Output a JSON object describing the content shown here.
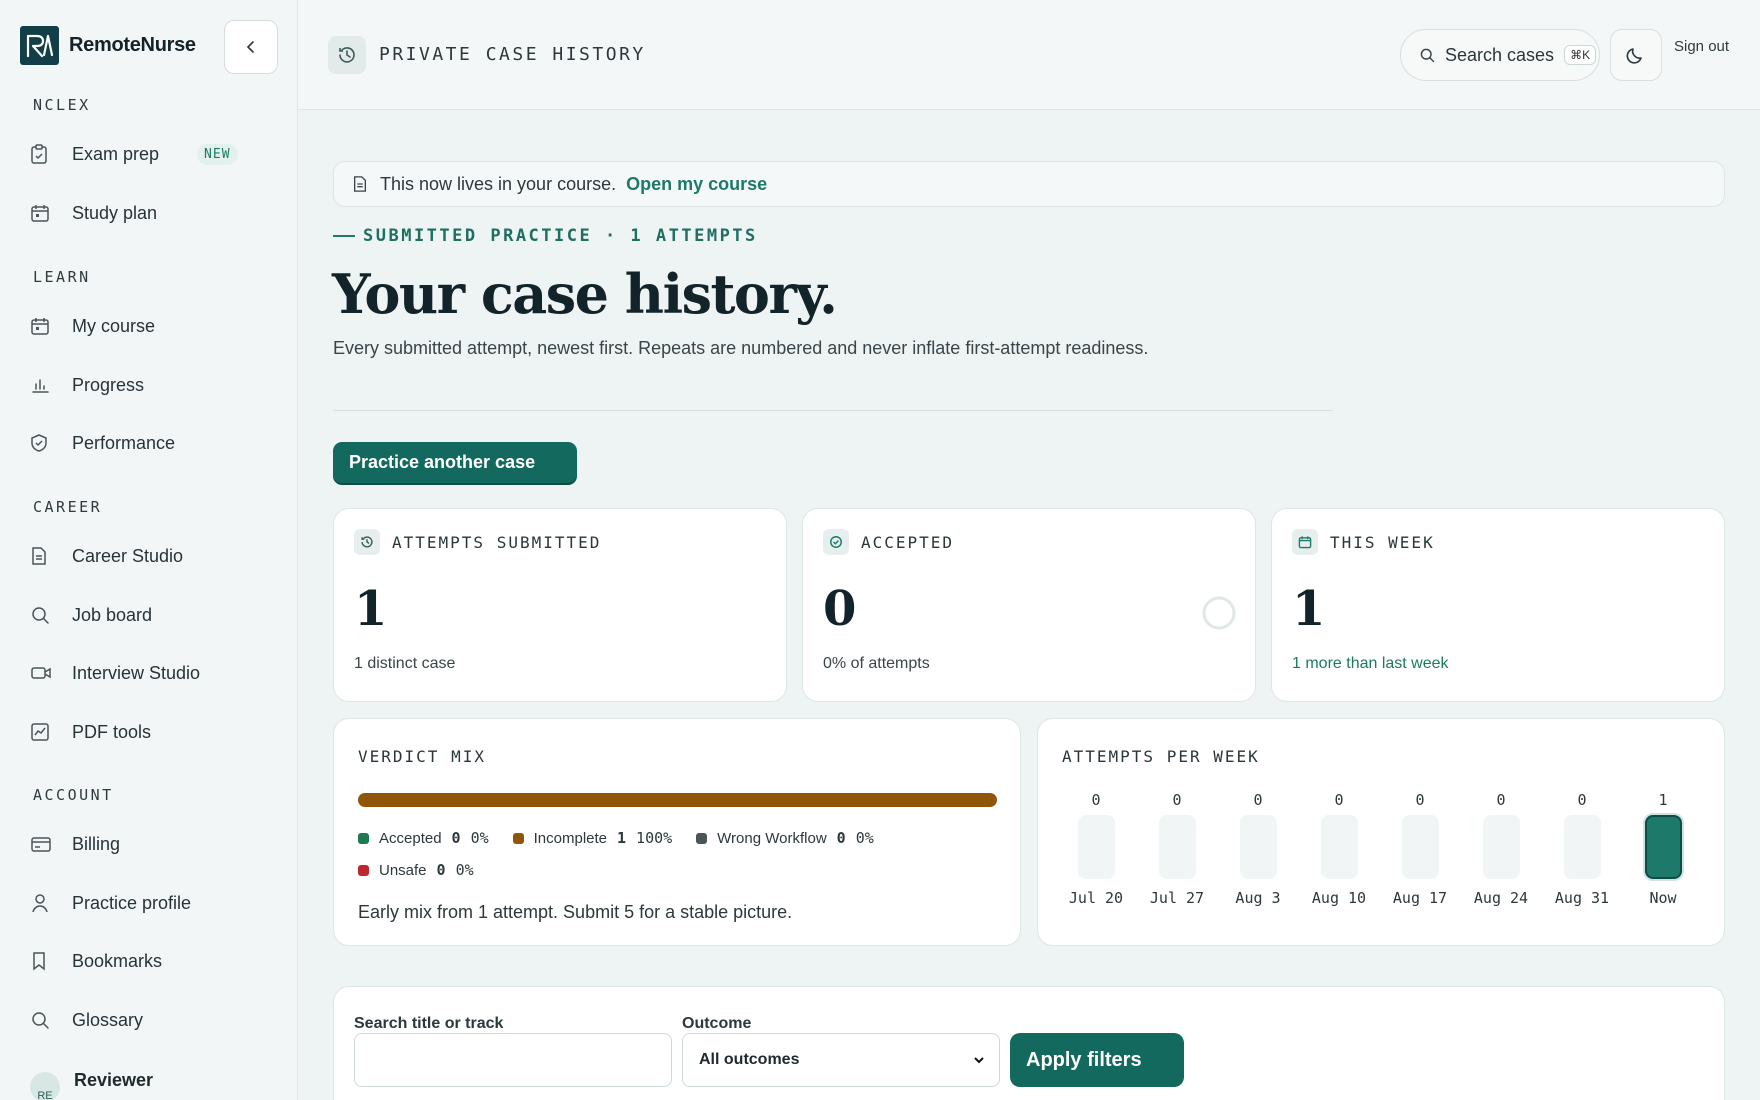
{
  "brand": {
    "name": "RemoteNurse",
    "logo_text": "RN"
  },
  "sidebar": {
    "sections": [
      {
        "label": "NCLEX",
        "items": [
          {
            "label": "Exam prep",
            "icon": "clipboard-check-icon",
            "badge": "NEW"
          },
          {
            "label": "Study plan",
            "icon": "calendar-icon"
          }
        ]
      },
      {
        "label": "LEARN",
        "items": [
          {
            "label": "My course",
            "icon": "calendar-icon"
          },
          {
            "label": "Progress",
            "icon": "bar-chart-icon"
          },
          {
            "label": "Performance",
            "icon": "shield-icon"
          }
        ]
      },
      {
        "label": "CAREER",
        "items": [
          {
            "label": "Career Studio",
            "icon": "document-icon"
          },
          {
            "label": "Job board",
            "icon": "search-icon"
          },
          {
            "label": "Interview Studio",
            "icon": "video-icon"
          },
          {
            "label": "PDF tools",
            "icon": "chart-box-icon"
          }
        ]
      },
      {
        "label": "ACCOUNT",
        "items": [
          {
            "label": "Billing",
            "icon": "card-icon"
          },
          {
            "label": "Practice profile",
            "icon": "user-icon"
          },
          {
            "label": "Bookmarks",
            "icon": "bookmark-icon"
          },
          {
            "label": "Glossary",
            "icon": "search-icon"
          }
        ]
      }
    ],
    "user": {
      "initials": "RE",
      "name": "Reviewer"
    }
  },
  "topbar": {
    "title": "PRIVATE CASE HISTORY",
    "search_label": "Search cases",
    "search_shortcut": "⌘K",
    "signout": "Sign out"
  },
  "notice": {
    "text": "This now lives in your course.",
    "link": "Open my course"
  },
  "header": {
    "eyebrow": "SUBMITTED PRACTICE · 1 ATTEMPTS",
    "title": "Your case history.",
    "subtitle": "Every submitted attempt, newest first. Repeats are numbered and never inflate first-attempt readiness.",
    "primary_button": "Practice another case"
  },
  "stats": [
    {
      "label": "ATTEMPTS SUBMITTED",
      "value": "1",
      "sub": "1 distinct case",
      "icon": "history-icon"
    },
    {
      "label": "ACCEPTED",
      "value": "0",
      "sub": "0% of attempts",
      "icon": "check-circle-icon",
      "ring_fraction": 0
    },
    {
      "label": "THIS WEEK",
      "value": "1",
      "sub": "1 more than last week",
      "icon": "calendar-icon"
    }
  ],
  "verdict_mix": {
    "label": "VERDICT MIX",
    "segments": [
      {
        "name": "Accepted",
        "count": "0",
        "pct": "0%",
        "color": "#1f7a4f"
      },
      {
        "name": "Incomplete",
        "count": "1",
        "pct": "100%",
        "color": "#8f5609"
      },
      {
        "name": "Wrong Workflow",
        "count": "0",
        "pct": "0%",
        "color": "#4b5558"
      },
      {
        "name": "Unsafe",
        "count": "0",
        "pct": "0%",
        "color": "#c0262d"
      }
    ],
    "note": "Early mix from 1 attempt. Submit 5 for a stable picture."
  },
  "weekly": {
    "label": "ATTEMPTS PER WEEK",
    "weeks": [
      {
        "label": "Jul 20",
        "value": "0"
      },
      {
        "label": "Jul 27",
        "value": "0"
      },
      {
        "label": "Aug 3",
        "value": "0"
      },
      {
        "label": "Aug 10",
        "value": "0"
      },
      {
        "label": "Aug 17",
        "value": "0"
      },
      {
        "label": "Aug 24",
        "value": "0"
      },
      {
        "label": "Aug 31",
        "value": "0"
      },
      {
        "label": "Now",
        "value": "1"
      }
    ]
  },
  "filters": {
    "search_label": "Search title or track",
    "search_value": "",
    "outcome_label": "Outcome",
    "outcome_value": "All outcomes",
    "apply": "Apply filters"
  },
  "colors": {
    "accent": "#13695d",
    "brand_dark": "#123f47"
  }
}
